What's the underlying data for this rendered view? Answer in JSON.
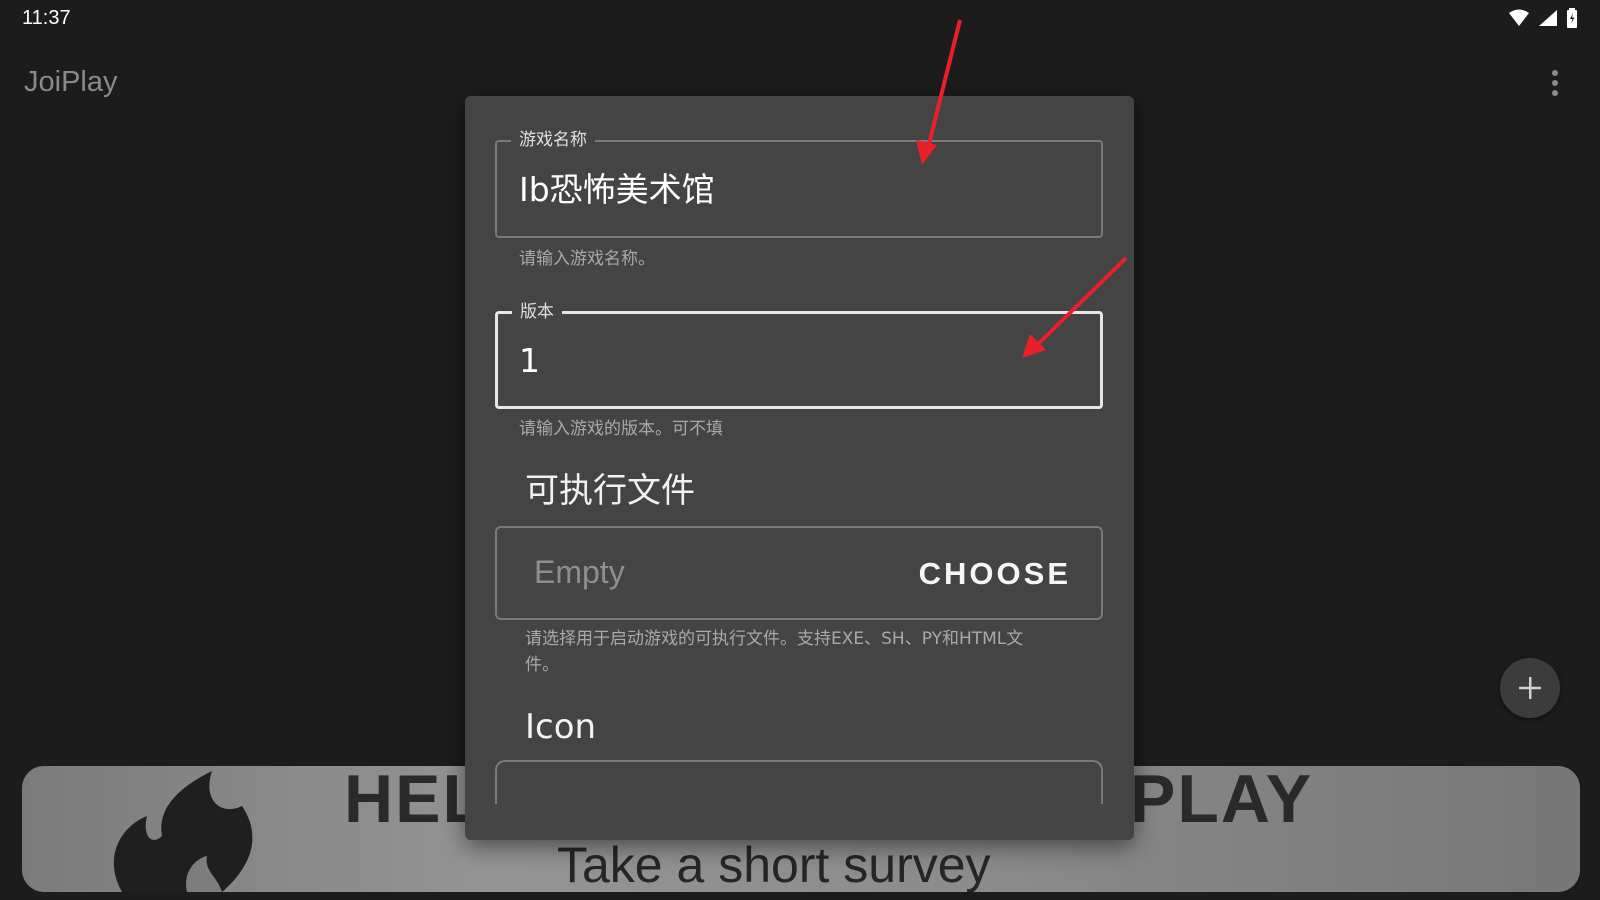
{
  "status_bar": {
    "time": "11:37",
    "icons": [
      "wifi-icon",
      "signal-icon",
      "battery-icon"
    ]
  },
  "app_bar": {
    "title": "JoiPlay",
    "menu_icon": "overflow-menu-icon"
  },
  "dialog": {
    "name_field": {
      "label": "游戏名称",
      "value": "Ib恐怖美术馆",
      "helper": "请输入游戏名称。"
    },
    "version_field": {
      "label": "版本",
      "value": "1",
      "helper": "请输入游戏的版本。可不填"
    },
    "executable": {
      "title": "可执行文件",
      "value": "Empty",
      "button": "CHOOSE",
      "helper_line1": "请选择用于启动游戏的可执行文件。支持EXE、SH、PY和HTML文",
      "helper_line2": "件。"
    },
    "icon_section": {
      "title": "Icon"
    }
  },
  "banner": {
    "heading_left": "HEL",
    "heading_right": "PLAY",
    "subtitle": "Take a short survey"
  },
  "fab": {
    "icon": "plus-icon"
  },
  "annotations": {
    "arrow_color": "#e8202a"
  },
  "colors": {
    "background": "#1c1c1c",
    "dialog": "#444444",
    "accent_text": "#ffffff"
  }
}
